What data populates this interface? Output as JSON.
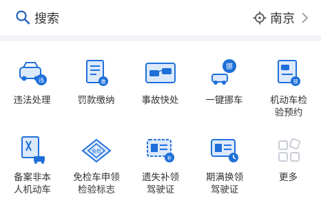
{
  "search": {
    "placeholder": "搜索"
  },
  "location": {
    "city": "南京"
  },
  "services": [
    {
      "label": "违法处理",
      "icon": "car-badge-icon"
    },
    {
      "label": "罚款缴纳",
      "icon": "fine-document-icon"
    },
    {
      "label": "事故快处",
      "icon": "accident-cars-icon"
    },
    {
      "label": "一键挪车",
      "icon": "move-car-icon"
    },
    {
      "label": "机动车检验预约",
      "icon": "vehicle-inspection-icon"
    },
    {
      "label": "备案非本人机动车",
      "icon": "registration-icon"
    },
    {
      "label": "免检车申领检验标志",
      "icon": "exemption-tag-icon"
    },
    {
      "label": "遗失补领驾驶证",
      "icon": "replace-license-icon"
    },
    {
      "label": "期满换领驾驶证",
      "icon": "renew-license-icon"
    },
    {
      "label": "更多",
      "icon": "more-grid-icon"
    }
  ],
  "colors": {
    "accent": "#1e6fd9",
    "accent_light": "#dce9fb",
    "icon_gray": "#c8ced6"
  }
}
